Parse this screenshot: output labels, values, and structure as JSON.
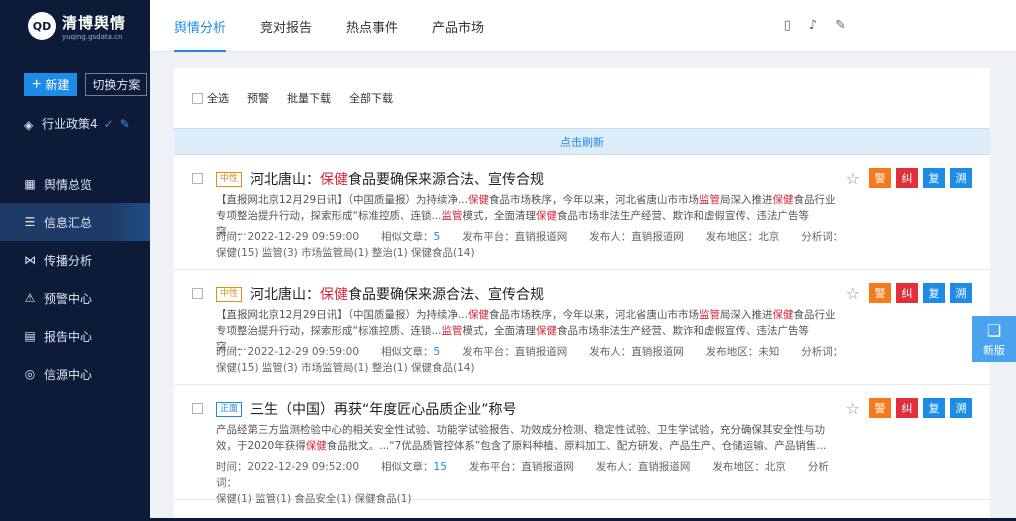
{
  "brand": {
    "mark": "QD",
    "title": "清博舆情",
    "subtitle": "yuqing.gsdata.cn"
  },
  "sidebar": {
    "new_label": "新建",
    "switch_label": "切换方案",
    "policy_label": "行业政策4",
    "items": [
      {
        "label": "舆情总览",
        "icon": "grid-icon"
      },
      {
        "label": "信息汇总",
        "icon": "list-icon"
      },
      {
        "label": "传播分析",
        "icon": "share-icon"
      },
      {
        "label": "预警中心",
        "icon": "alarm-icon"
      },
      {
        "label": "报告中心",
        "icon": "report-icon"
      },
      {
        "label": "信源中心",
        "icon": "source-icon"
      }
    ]
  },
  "topbar": {
    "tabs": [
      "舆情分析",
      "竞对报告",
      "热点事件",
      "产品市场"
    ],
    "active_tab": 0,
    "icons": [
      "phone-icon",
      "bell-icon",
      "edit-icon"
    ]
  },
  "toolbar": {
    "select_all": "全选",
    "warn": "预警",
    "batch_download": "批量下载",
    "download_all": "全部下载"
  },
  "refresh_label": "点击刷新",
  "actions": {
    "warn": "警",
    "fix": "纠",
    "review": "复",
    "trace": "溯"
  },
  "items": [
    {
      "tag": "中性",
      "title_pre": "河北唐山：",
      "title_hl": "保健",
      "title_post": "食品要确保来源合法、宣传合规",
      "desc_line1_a": "【直报网北京12月29日讯】（中国质量报）为持续净...",
      "desc_line1_b": "保健",
      "desc_line1_c": "食品市场秩序，今年以来，河北省唐山市市场",
      "desc_line1_d": "监管",
      "desc_line1_e": "局深入推进",
      "desc_line1_f": "保健",
      "desc_line1_g": "食品行业",
      "desc_line2_a": "专项整治提升行动，探索形成“标准控质、连锁...",
      "desc_line2_b": "监管",
      "desc_line2_c": "模式，全面清理",
      "desc_line2_d": "保健",
      "desc_line2_e": "食品市场非法生产经营、欺诈和虚假宣传、违法广告等突......",
      "time": "时间：2022-12-29 09:59:00",
      "similar_label": "相似文章：",
      "similar_num": "5",
      "platform": "发布平台：直销报道网",
      "publisher": "发布人：直销报道网",
      "region": "发布地区：北京",
      "analysis_label": "分析词：",
      "keywords": "保健(15) 监管(3) 市场监管局(1) 整治(1) 保健食品(14)"
    },
    {
      "tag": "中性",
      "title_pre": "河北唐山：",
      "title_hl": "保健",
      "title_post": "食品要确保来源合法、宣传合规",
      "desc_line1_a": "【直报网北京12月29日讯】（中国质量报）为持续净...",
      "desc_line1_b": "保健",
      "desc_line1_c": "食品市场秩序，今年以来，河北省唐山市市场",
      "desc_line1_d": "监管",
      "desc_line1_e": "局深入推进",
      "desc_line1_f": "保健",
      "desc_line1_g": "食品行业",
      "desc_line2_a": "专项整治提升行动，探索形成“标准控质、连锁...",
      "desc_line2_b": "监管",
      "desc_line2_c": "模式，全面清理",
      "desc_line2_d": "保健",
      "desc_line2_e": "食品市场非法生产经营、欺诈和虚假宣传、违法广告等突......",
      "time": "时间：2022-12-29 09:59:00",
      "similar_label": "相似文章：",
      "similar_num": "5",
      "platform": "发布平台：直销报道网",
      "publisher": "发布人：直销报道网",
      "region": "发布地区：未知",
      "analysis_label": "分析词：",
      "keywords": "保健(15) 监管(3) 市场监管局(1) 整治(1) 保健食品(14)"
    },
    {
      "tag": "正面",
      "title_pre": "三生（中国）再获“年度匠心品质企业”称号",
      "title_hl": "",
      "title_post": "",
      "desc_line1_a": "产品经第三方监测检验中心的相关安全性试验、功能学试验报告、功效成分检测、稳定性试验、卫生学试验，充分确保其安全性与功",
      "desc_line1_b": "",
      "desc_line1_c": "",
      "desc_line1_d": "",
      "desc_line1_e": "",
      "desc_line1_f": "",
      "desc_line1_g": "",
      "desc_line2_a": "效，于2020年获得",
      "desc_line2_b": "保健",
      "desc_line2_c": "食品批文。...“7优品质管控体系”包含了原料种植、原料加工、配方研发、产品生产、仓储运输、产品销售...",
      "desc_line2_d": "",
      "desc_line2_e": "",
      "time": "时间：2022-12-29 09:52:00",
      "similar_label": "相似文章：",
      "similar_num": "15",
      "platform": "发布平台：直销报道网",
      "publisher": "发布人：直销报道网",
      "region": "发布地区：北京",
      "analysis_label": "分析词：",
      "keywords": "保健(1) 监管(1) 食品安全(1) 保健食品(1)"
    }
  ],
  "float_new_label": "新版",
  "colors": {
    "sidebar_bg": "#0d1b38",
    "accent": "#1e8ce6",
    "warn": "#f37b1d",
    "danger": "#e0303e",
    "highlight": "#d7283b"
  }
}
